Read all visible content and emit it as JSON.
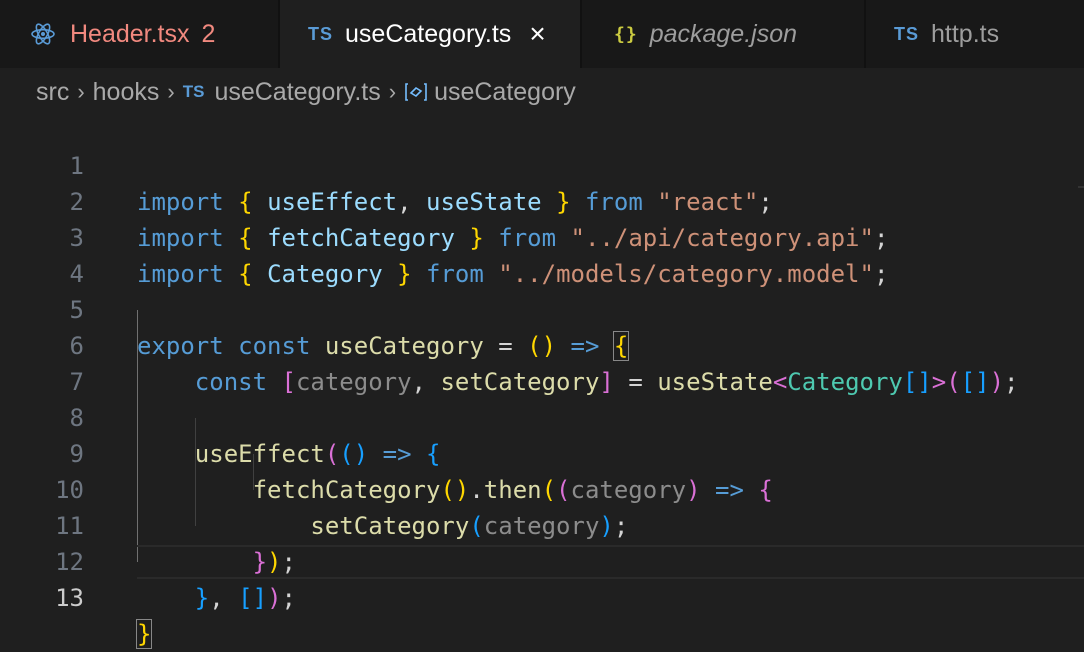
{
  "tabs": [
    {
      "label": "Header.tsx",
      "problems": "2",
      "icon": "react-icon",
      "state": "modified"
    },
    {
      "label": "useCategory.ts",
      "icon_text": "TS",
      "icon": "typescript-icon",
      "state": "active",
      "close": "×"
    },
    {
      "label": "package.json",
      "icon_text": "{}",
      "icon": "json-icon",
      "state": "preview"
    },
    {
      "label": "http.ts",
      "icon_text": "TS",
      "icon": "typescript-icon",
      "state": "inactive"
    }
  ],
  "breadcrumb": {
    "items": [
      "src",
      "hooks",
      "useCategory.ts",
      "useCategory"
    ],
    "file_icon_text": "TS",
    "separator": "›"
  },
  "editor": {
    "active_line": 13,
    "line_numbers": [
      "1",
      "2",
      "3",
      "4",
      "5",
      "6",
      "7",
      "8",
      "9",
      "10",
      "11",
      "12",
      "13"
    ],
    "tokens": {
      "import": "import",
      "from": "from",
      "export": "export",
      "const": "const",
      "useEffect": "useEffect",
      "useState": "useState",
      "fetchCategory": "fetchCategory",
      "Category": "Category",
      "useCategory": "useCategory",
      "category": "category",
      "setCategory": "setCategory",
      "then": "then",
      "react_str": "\"react\"",
      "api_str": "\"../api/category.api\"",
      "model_str": "\"../models/category.model\""
    }
  },
  "colors": {
    "keyword": "#569cd6",
    "string": "#ce9178",
    "function": "#dcdcaa",
    "type": "#4ec9b0",
    "bracket_1": "#ffd700",
    "bracket_2": "#da70d6",
    "bracket_3": "#179fff"
  }
}
